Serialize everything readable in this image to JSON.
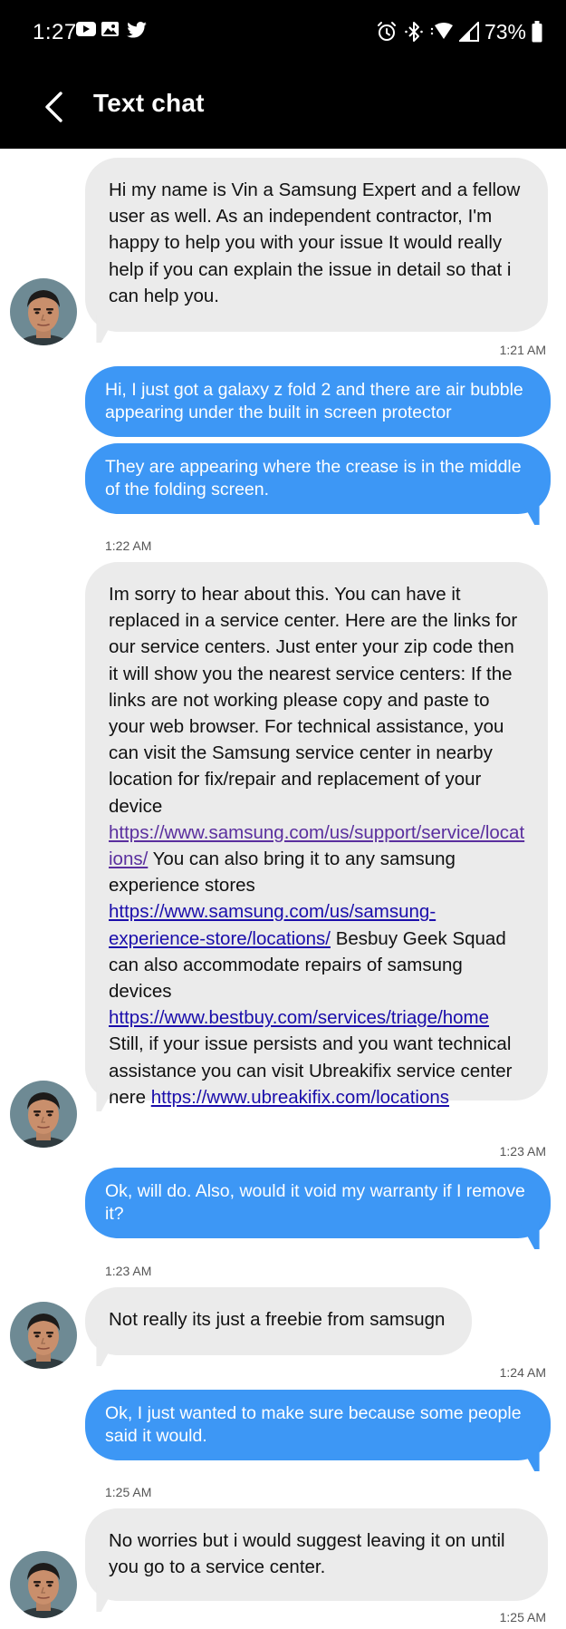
{
  "status_bar": {
    "time": "1:27",
    "battery": "73%",
    "left_icons": [
      "youtube-icon",
      "gallery-icon",
      "twitter-icon"
    ],
    "right_icons": [
      "alarm-icon",
      "bluetooth-icon",
      "wifi-icon",
      "cell-signal-icon",
      "battery-icon"
    ]
  },
  "app_bar": {
    "title": "Text chat",
    "back_icon": "back-arrow-icon"
  },
  "messages": [
    {
      "from": "agent",
      "text": "Hi my name is Vin a Samsung Expert and a fellow user as well. As an independent contractor, I'm happy to help you with your issue It would really help if you can explain the issue in detail so that i can help you.",
      "time": "1:21 AM"
    },
    {
      "from": "user",
      "text": "Hi, I just got a galaxy z fold 2 and there are air bubble appearing under the built in screen protector"
    },
    {
      "from": "user",
      "text": "They are appearing where the crease is in the middle of the folding screen.",
      "time": "1:22 AM"
    },
    {
      "from": "agent",
      "text_1": "Im sorry to hear about this. You can have it replaced in a service center. Here are the links for our service centers. Just enter your zip code then it will show you the nearest service centers: If the links are not working please copy and paste to your web browser. For technical assistance, you can visit the Samsung service center in nearby location for fix/repair and replacement of your device",
      "link_1": "https://www.samsung.com/us/support/service/locations/",
      "text_2": " You can also bring it to any samsung experience stores",
      "link_2": "https://www.samsung.com/us/samsung-experience-store/locations/",
      "text_3": " Besbuy Geek Squad can also accommodate repairs of samsung devices",
      "link_3": "https://www.bestbuy.com/services/triage/home",
      "text_4": "Still, if your issue persists and you want technical assistance you can visit Ubreakifix service center here ",
      "link_4": "https://www.ubreakifix.com/locations",
      "time": "1:23 AM"
    },
    {
      "from": "user",
      "text": "Ok, will do. Also, would it void my warranty if I remove it?",
      "time": "1:23 AM"
    },
    {
      "from": "agent",
      "text": "Not really its just a freebie from samsugn",
      "time": "1:24 AM"
    },
    {
      "from": "user",
      "text": "Ok, I just wanted to make sure because some people said it would.",
      "time": "1:25 AM"
    },
    {
      "from": "agent",
      "text": "No worries but i would suggest leaving it on until you go to a service center.",
      "time": "1:25 AM"
    }
  ],
  "colors": {
    "sent_bubble": "#3d97f5",
    "received_bubble": "#ebebeb",
    "link": "#1a0dab",
    "visited_link": "#5a2f9e",
    "header": "#000000"
  }
}
